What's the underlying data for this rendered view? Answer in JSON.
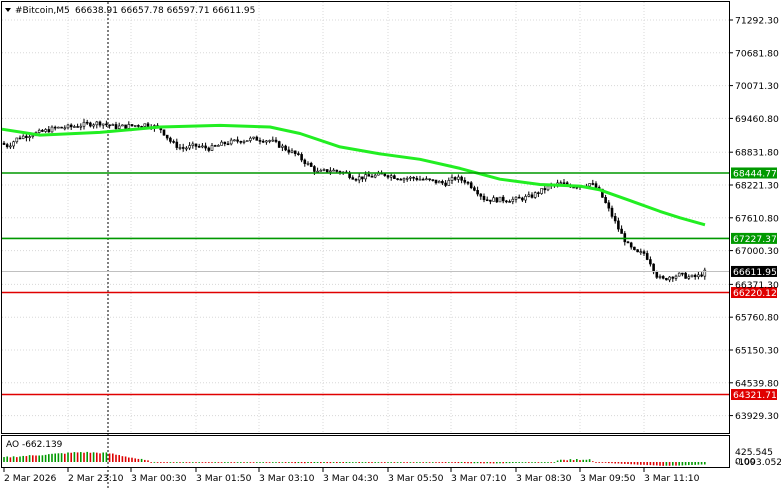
{
  "header": {
    "symbol": "#Bitcoin,M5",
    "ohlc": "66638.91 66657.78 66597.71 66611.95"
  },
  "price_axis": {
    "ticks": [
      "71292.30",
      "70681.80",
      "70071.30",
      "69460.80",
      "68831.80",
      "68221.30",
      "67610.80",
      "67000.30",
      "66371.30",
      "65760.80",
      "65150.30",
      "64539.80",
      "63929.30"
    ]
  },
  "levels": [
    {
      "label": "68444.77",
      "price": 68444.77,
      "color": "#009900"
    },
    {
      "label": "67227.37",
      "price": 67227.37,
      "color": "#009900"
    },
    {
      "label": "66220.12",
      "price": 66220.12,
      "color": "#e00000"
    },
    {
      "label": "64321.71",
      "price": 64321.71,
      "color": "#e00000"
    }
  ],
  "current_price": {
    "label": "66611.95",
    "price": 66611.95
  },
  "indicator": {
    "title": "AO -662.139",
    "ticks": [
      "425.545",
      "0.00",
      "-1093.052"
    ]
  },
  "time_axis": {
    "labels": [
      "2 Mar 2026",
      "2 Mar 23:10",
      "3 Mar 00:30",
      "3 Mar 01:50",
      "3 Mar 03:10",
      "3 Mar 04:30",
      "3 Mar 05:50",
      "3 Mar 07:10",
      "3 Mar 08:30",
      "3 Mar 09:50",
      "3 Mar 11:10"
    ]
  },
  "colors": {
    "ma": "#22ee22",
    "candle": "#000000",
    "ao_up": "#009900",
    "ao_down": "#dd0000",
    "support": "#e00000",
    "resistance": "#009900"
  }
}
